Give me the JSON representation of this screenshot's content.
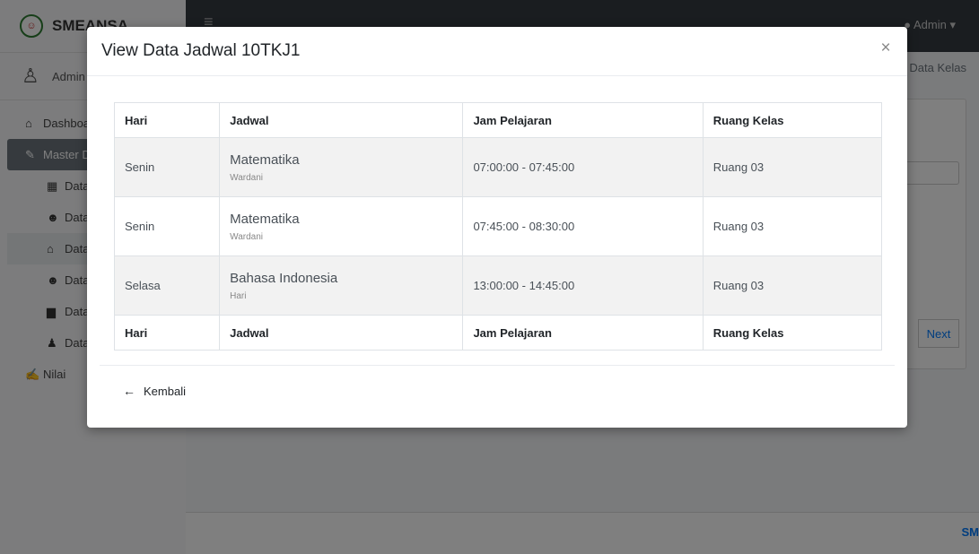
{
  "app": {
    "brand": "SMEANSA",
    "user": "Admin",
    "topbar_user": "Admin",
    "breadcrumb": "/ Data Kelas",
    "footer_text": "SM"
  },
  "sidebar": {
    "items": [
      {
        "label": "Dashboard",
        "icon": "home-icon"
      },
      {
        "label": "Master Data",
        "icon": "edit-icon"
      },
      {
        "label": "Data",
        "icon": "calendar-icon"
      },
      {
        "label": "Data",
        "icon": "users-icon"
      },
      {
        "label": "Data",
        "icon": "home-icon"
      },
      {
        "label": "Data",
        "icon": "users-icon"
      },
      {
        "label": "Data",
        "icon": "book-icon"
      },
      {
        "label": "Data",
        "icon": "user-plus-icon"
      },
      {
        "label": "Nilai",
        "icon": "chart-icon"
      }
    ]
  },
  "background": {
    "next_label": "Next"
  },
  "modal": {
    "title": "View Data Jadwal 10TKJ1",
    "close_label": "×",
    "table": {
      "headers": [
        "Hari",
        "Jadwal",
        "Jam Pelajaran",
        "Ruang Kelas"
      ],
      "rows": [
        {
          "hari": "Senin",
          "subject": "Matematika",
          "teacher": "Wardani",
          "jam": "07:00:00 - 07:45:00",
          "ruang": "Ruang 03"
        },
        {
          "hari": "Senin",
          "subject": "Matematika",
          "teacher": "Wardani",
          "jam": "07:45:00 - 08:30:00",
          "ruang": "Ruang 03"
        },
        {
          "hari": "Selasa",
          "subject": "Bahasa Indonesia",
          "teacher": "Hari",
          "jam": "13:00:00 - 14:45:00",
          "ruang": "Ruang 03"
        }
      ],
      "footers": [
        "Hari",
        "Jadwal",
        "Jam Pelajaran",
        "Ruang Kelas"
      ]
    },
    "back_label": "Kembali"
  }
}
